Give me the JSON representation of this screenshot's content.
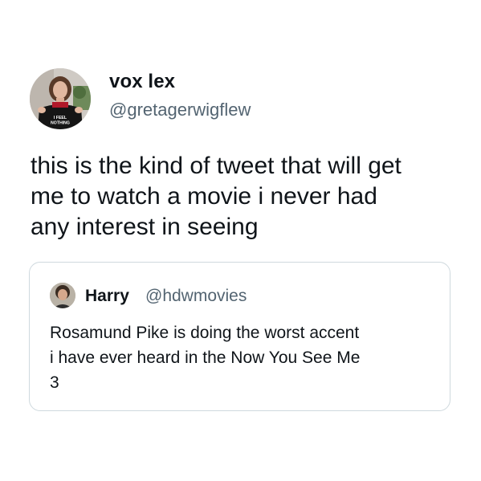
{
  "tweet": {
    "display_name": "vox lex",
    "handle": "@gretagerwigflew",
    "avatar_shirt_text": [
      "I FEEL",
      "NOTHING"
    ],
    "text_lines": [
      "this is the kind of tweet that will get",
      "me to watch a movie i never had",
      "any interest in seeing"
    ]
  },
  "quoted_tweet": {
    "display_name": "Harry",
    "handle": "@hdwmovies",
    "text_lines": [
      "Rosamund Pike is doing the worst accent",
      "i have ever heard in the Now You See Me",
      "3"
    ]
  },
  "colors": {
    "text": "#0f1419",
    "secondary_text": "#536471",
    "card_border": "#cfd9de",
    "background": "#ffffff"
  }
}
